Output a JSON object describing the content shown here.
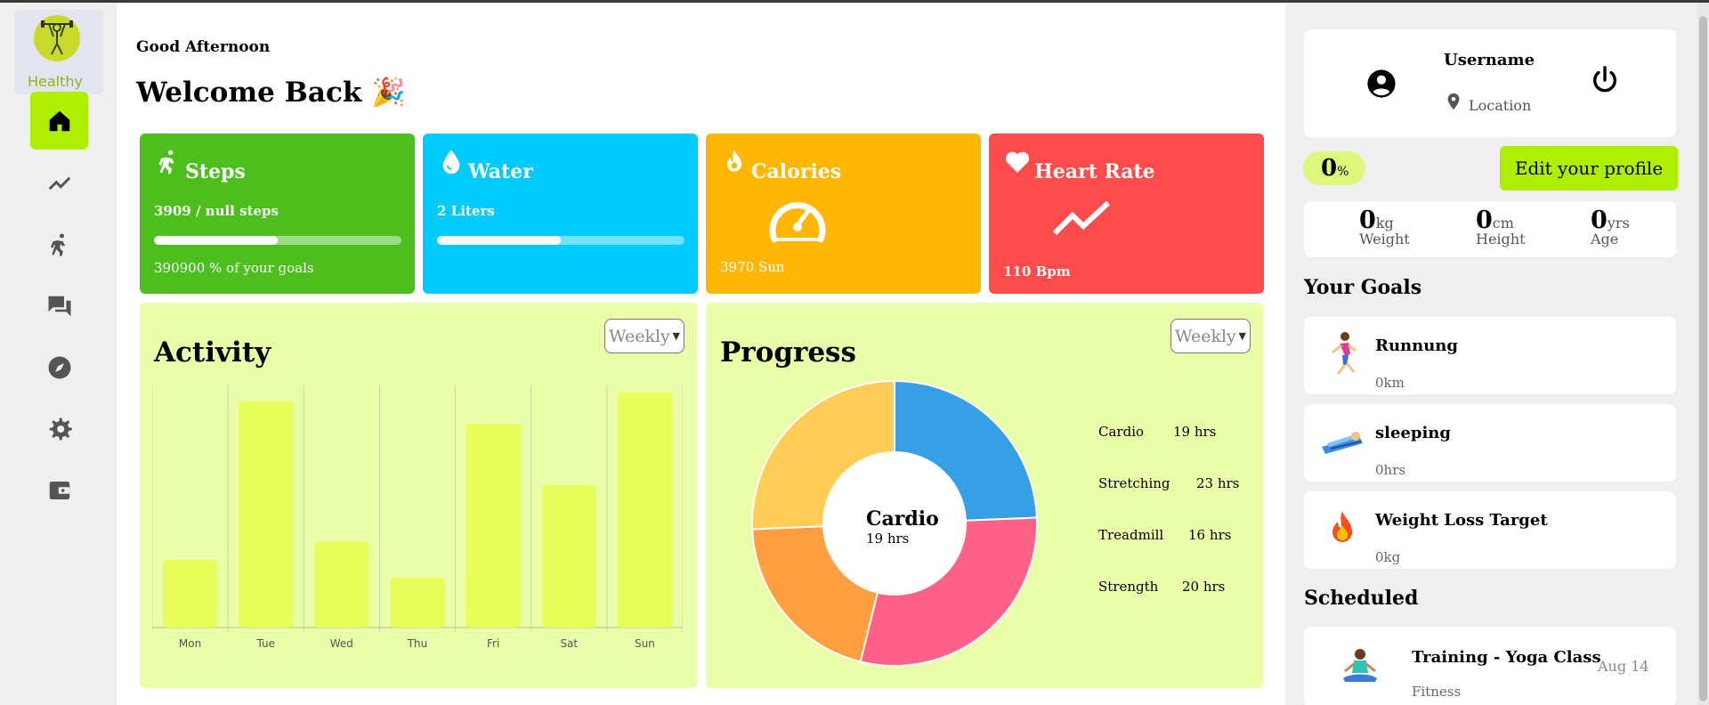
{
  "brand": {
    "name": "Healthy",
    "accent": "#aeee00"
  },
  "nav": [
    {
      "name": "home-icon",
      "active": true
    },
    {
      "name": "trending-icon",
      "active": false
    },
    {
      "name": "run-icon",
      "active": false
    },
    {
      "name": "chat-icon",
      "active": false
    },
    {
      "name": "compass-icon",
      "active": false
    },
    {
      "name": "gear-icon",
      "active": false
    },
    {
      "name": "wallet-icon",
      "active": false
    }
  ],
  "header": {
    "greeting": "Good Afternoon",
    "welcome": "Welcome Back 🎉"
  },
  "stats": {
    "steps": {
      "title": "Steps",
      "line1": "3909 / null steps",
      "line2": "390900 % of your goals",
      "progress": 0.5,
      "color": "#4cbf1f"
    },
    "water": {
      "title": "Water",
      "line1": "2 Liters",
      "progress": 0.5,
      "color": "#00cbff"
    },
    "calories": {
      "title": "Calories",
      "line1": "3970 Sun",
      "color": "#ffb703"
    },
    "heart": {
      "title": "Heart Rate",
      "line1": "110 Bpm",
      "color": "#ff4b4b"
    }
  },
  "activity": {
    "title": "Activity",
    "select": "Weekly"
  },
  "progress": {
    "title": "Progress",
    "select": "Weekly",
    "center_title": "Cardio",
    "center_sub": "19 hrs",
    "legend": [
      {
        "label": "Cardio",
        "value": "19 hrs"
      },
      {
        "label": "Stretching",
        "value": "23 hrs"
      },
      {
        "label": "Treadmill",
        "value": "16 hrs"
      },
      {
        "label": "Strength",
        "value": "20 hrs"
      }
    ]
  },
  "chart_data": [
    {
      "type": "bar",
      "categories": [
        "Mon",
        "Tue",
        "Wed",
        "Thu",
        "Fri",
        "Sat",
        "Sun"
      ],
      "values": [
        30,
        100,
        38,
        22,
        90,
        63,
        104
      ],
      "ylim": [
        0,
        107
      ],
      "grid": "vertical",
      "color": "#e6fd5a"
    },
    {
      "type": "pie",
      "labels": [
        "Cardio",
        "Stretching",
        "Treadmill",
        "Strength"
      ],
      "values": [
        19,
        23,
        16,
        20
      ],
      "colors": [
        "#369fe6",
        "#ff6286",
        "#ff9f40",
        "#ffcd56"
      ],
      "donut": true
    }
  ],
  "profile": {
    "username": "Username",
    "location": "Location",
    "percent": "0",
    "percent_unit": "%",
    "edit_label": "Edit your profile",
    "weight": {
      "value": "0",
      "unit": "kg",
      "label": "Weight"
    },
    "height": {
      "value": "0",
      "unit": "cm",
      "label": "Height"
    },
    "age": {
      "value": "0",
      "unit": "yrs",
      "label": "Age"
    }
  },
  "goals": {
    "title": "Your Goals",
    "items": [
      {
        "name": "Runnung",
        "value": "0km"
      },
      {
        "name": "sleeping",
        "value": "0hrs"
      },
      {
        "name": "Weight Loss Target",
        "value": "0kg"
      }
    ]
  },
  "scheduled": {
    "title": "Scheduled",
    "items": [
      {
        "name": "Training - Yoga Class",
        "type": "Fitness",
        "date": "Aug 14"
      }
    ]
  }
}
